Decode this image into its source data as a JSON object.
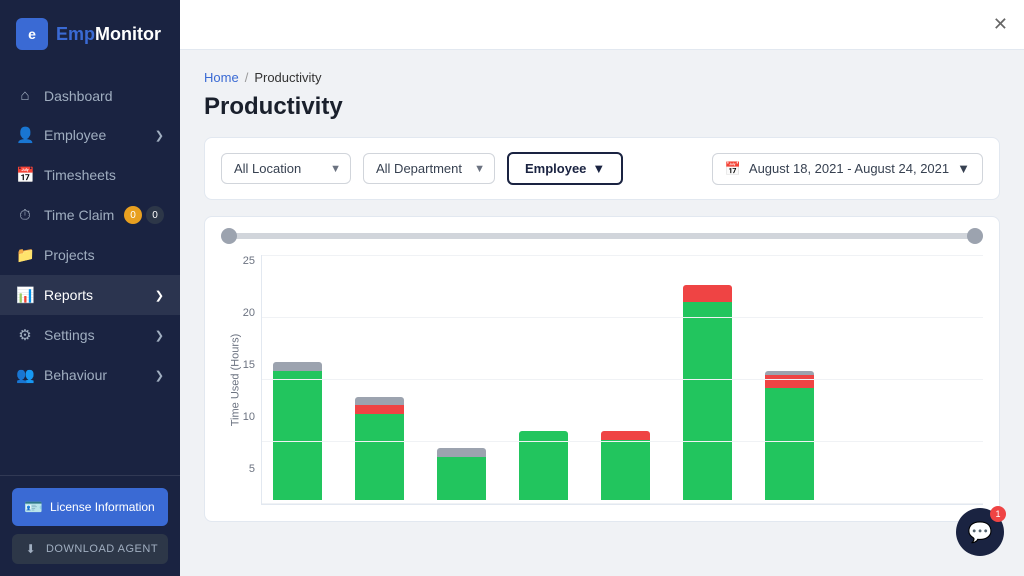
{
  "sidebar": {
    "logo": {
      "icon_text": "e",
      "text_emp": "Emp",
      "text_monitor": "Monitor"
    },
    "nav_items": [
      {
        "id": "dashboard",
        "label": "Dashboard",
        "icon": "⌂",
        "has_arrow": false,
        "has_badge": false
      },
      {
        "id": "employee",
        "label": "Employee",
        "icon": "👤",
        "has_arrow": true,
        "has_badge": false
      },
      {
        "id": "timesheets",
        "label": "Timesheets",
        "icon": "📅",
        "has_arrow": false,
        "has_badge": false
      },
      {
        "id": "time-claim",
        "label": "Time Claim",
        "icon": "⏱",
        "has_arrow": false,
        "has_badge": true,
        "badge1": "0",
        "badge2": "0"
      },
      {
        "id": "projects",
        "label": "Projects",
        "icon": "📁",
        "has_arrow": false,
        "has_badge": false
      },
      {
        "id": "reports",
        "label": "Reports",
        "icon": "📊",
        "has_arrow": true,
        "has_badge": false
      },
      {
        "id": "settings",
        "label": "Settings",
        "icon": "⚙",
        "has_arrow": true,
        "has_badge": false
      },
      {
        "id": "behaviour",
        "label": "Behaviour",
        "icon": "👥",
        "has_arrow": true,
        "has_badge": false
      }
    ],
    "license_label": "License Information",
    "download_label": "DOWNLOAD AGENT"
  },
  "breadcrumb": {
    "home": "Home",
    "separator": "/",
    "current": "Productivity"
  },
  "page": {
    "title": "Productivity"
  },
  "filters": {
    "location_label": "All Location",
    "department_label": "All Department",
    "employee_label": "Employee",
    "date_range": "August 18, 2021 - August 24, 2021"
  },
  "chart": {
    "y_axis_label": "Time Used (Hours)",
    "y_labels": [
      "25",
      "20",
      "15",
      "10",
      "5"
    ],
    "bars": [
      {
        "gray": 16,
        "green": 15,
        "red": 0,
        "total": 16
      },
      {
        "gray": 12,
        "green": 10,
        "red": 1,
        "total": 12
      },
      {
        "gray": 6,
        "green": 5,
        "red": 0,
        "total": 6
      },
      {
        "gray": 8,
        "green": 8,
        "red": 0,
        "total": 8
      },
      {
        "gray": 8,
        "green": 7,
        "red": 1,
        "total": 8
      },
      {
        "gray": 25,
        "green": 23,
        "red": 2,
        "total": 25
      },
      {
        "gray": 15,
        "green": 13,
        "red": 1.5,
        "total": 15
      }
    ],
    "max_value": 25
  },
  "chat": {
    "icon": "💬",
    "badge": "1"
  }
}
